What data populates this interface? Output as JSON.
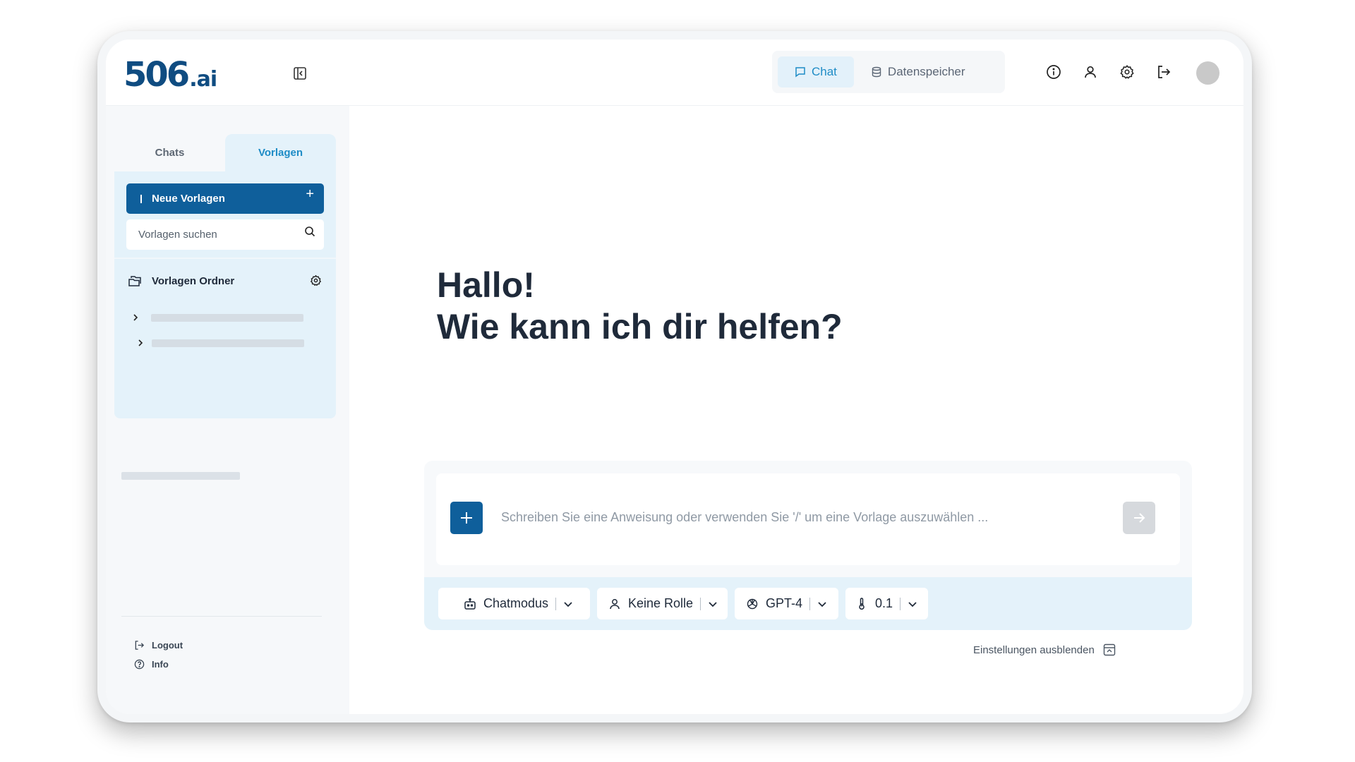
{
  "header": {
    "logo_main": "506",
    "logo_suffix": ".ai",
    "tabs": [
      {
        "label": "Chat",
        "icon": "message-icon",
        "active": true
      },
      {
        "label": "Datenspeicher",
        "icon": "database-icon",
        "active": false
      }
    ],
    "icons": [
      "info-icon",
      "user-icon",
      "gear-icon",
      "logout-icon"
    ],
    "active_color": "#1e8cc6"
  },
  "sidebar": {
    "tabs": [
      {
        "label": "Chats",
        "active": false
      },
      {
        "label": "Vorlagen",
        "active": true
      }
    ],
    "new_button_label": "Neue Vorlagen",
    "search_placeholder": "Vorlagen suchen",
    "folder_title": "Vorlagen Ordner",
    "links": [
      {
        "label": "Logout",
        "icon": "logout-icon"
      },
      {
        "label": "Info",
        "icon": "help-circle-icon"
      }
    ],
    "accent_color": "#0f5f9b",
    "panel_color": "#e4f2fa"
  },
  "main": {
    "greeting_line1": "Hallo!",
    "greeting_line2": "Wie kann ich dir helfen?",
    "prompt_placeholder": "Schreiben Sie eine Anweisung oder verwenden Sie '/' um eine Vorlage auszuwählen ...",
    "options": {
      "mode": "Chatmodus",
      "role": "Keine Rolle",
      "model": "GPT-4",
      "temperature": "0.1"
    },
    "hide_settings_label": "Einstellungen ausblenden"
  }
}
